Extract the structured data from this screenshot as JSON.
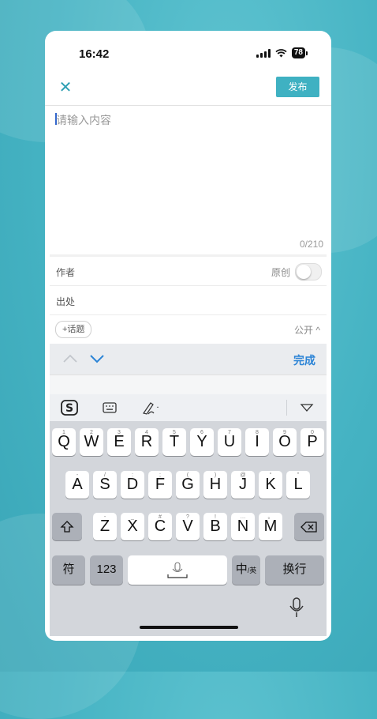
{
  "status_bar": {
    "time": "16:42",
    "battery": "78"
  },
  "header": {
    "close_icon": "close-icon",
    "publish_label": "发布"
  },
  "editor": {
    "placeholder": "请输入内容",
    "counter": "0/210"
  },
  "fields": {
    "author_label": "作者",
    "original_label": "原创",
    "original_enabled": false,
    "source_label": "出处",
    "topic_button": "+话题",
    "visibility": "公开 ^"
  },
  "accessory": {
    "done_label": "完成"
  },
  "keyboard": {
    "row1": [
      {
        "hint": "1",
        "key": "Q"
      },
      {
        "hint": "2",
        "key": "W"
      },
      {
        "hint": "3",
        "key": "E"
      },
      {
        "hint": "4",
        "key": "R"
      },
      {
        "hint": "5",
        "key": "T"
      },
      {
        "hint": "6",
        "key": "Y"
      },
      {
        "hint": "7",
        "key": "U"
      },
      {
        "hint": "8",
        "key": "I"
      },
      {
        "hint": "9",
        "key": "O"
      },
      {
        "hint": "0",
        "key": "P"
      }
    ],
    "row2": [
      {
        "hint": "-",
        "key": "A"
      },
      {
        "hint": "/",
        "key": "S"
      },
      {
        "hint": ":",
        "key": "D"
      },
      {
        "hint": ";",
        "key": "F"
      },
      {
        "hint": "(",
        "key": "G"
      },
      {
        "hint": ")",
        "key": "H"
      },
      {
        "hint": "@",
        "key": "J"
      },
      {
        "hint": "“",
        "key": "K"
      },
      {
        "hint": "”",
        "key": "L"
      }
    ],
    "row3": [
      {
        "hint": "-",
        "key": "Z"
      },
      {
        "hint": "_",
        "key": "X"
      },
      {
        "hint": "#",
        "key": "C"
      },
      {
        "hint": "?",
        "key": "V"
      },
      {
        "hint": "!",
        "key": "B"
      },
      {
        "hint": "…",
        "key": "N"
      },
      {
        "hint": "。",
        "key": "M"
      }
    ],
    "symbols_label": "符",
    "numbers_label": "123",
    "lang_label": "中",
    "lang_sub": "/英",
    "return_label": "换行"
  }
}
